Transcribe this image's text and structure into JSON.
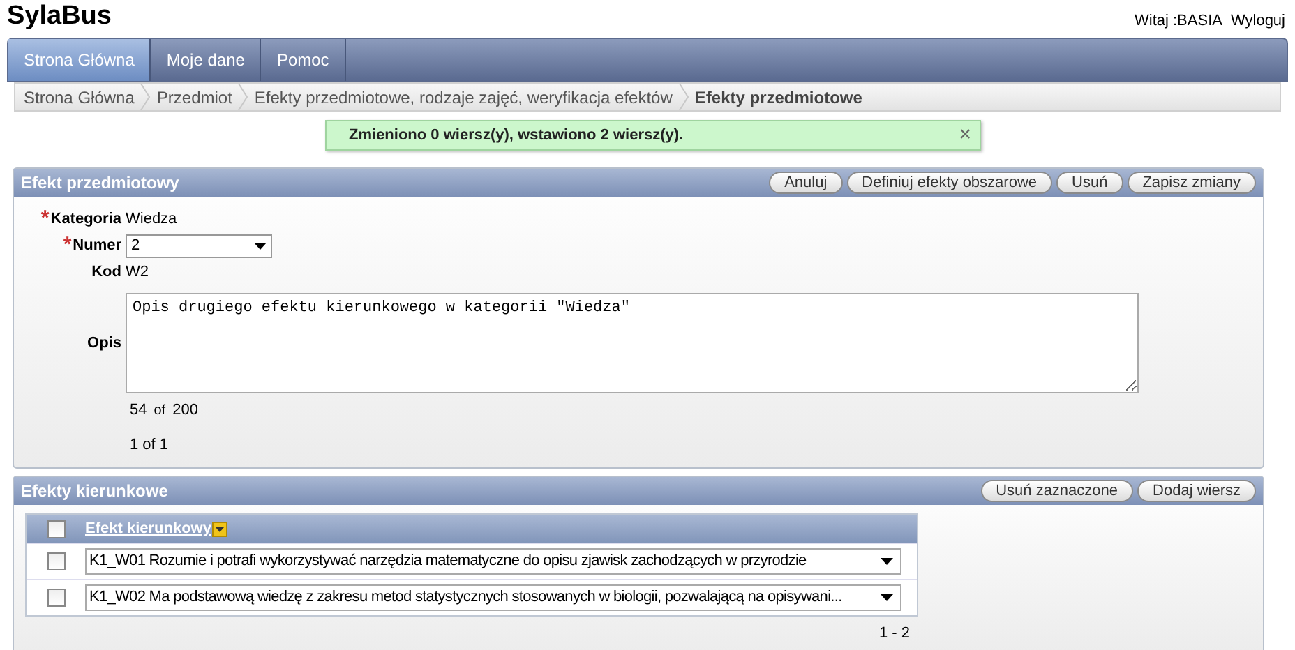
{
  "header": {
    "logo": "SylaBus",
    "greeting": "Witaj :BASIA",
    "logout": "Wyloguj"
  },
  "tabs": [
    {
      "label": "Strona Główna",
      "selected": true
    },
    {
      "label": "Moje dane",
      "selected": false
    },
    {
      "label": "Pomoc",
      "selected": false
    }
  ],
  "breadcrumb": [
    {
      "label": "Strona Główna",
      "current": false
    },
    {
      "label": "Przedmiot",
      "current": false
    },
    {
      "label": "Efekty przedmiotowe, rodzaje zajęć, weryfikacja efektów",
      "current": false
    },
    {
      "label": "Efekty przedmiotowe",
      "current": true
    }
  ],
  "message": {
    "text": "Zmieniono 0 wiersz(y), wstawiono 2 wiersz(y).",
    "close": "×"
  },
  "form_panel": {
    "title": "Efekt przedmiotowy",
    "buttons": [
      "Anuluj",
      "Definiuj efekty obszarowe",
      "Usuń",
      "Zapisz zmiany"
    ],
    "required_mark": "*",
    "fields": [
      {
        "kind": "text",
        "label": "Kategoria",
        "required": true,
        "value": "Wiedza"
      },
      {
        "kind": "select",
        "label": "Numer",
        "required": true,
        "value": "2"
      },
      {
        "kind": "text",
        "label": "Kod",
        "required": false,
        "value": "W2"
      },
      {
        "kind": "textarea",
        "label": "Opis",
        "required": false,
        "value": "Opis drugiego efektu kierunkowego w kategorii \"Wiedza\""
      }
    ],
    "counter": {
      "count": "54",
      "of": "of",
      "max": "200"
    },
    "pagination": "1 of 1"
  },
  "grid_panel": {
    "title": "Efekty kierunkowe",
    "buttons": [
      "Usuń zaznaczone",
      "Dodaj wiersz"
    ],
    "column": "Efekt kierunkowy",
    "header_checked": false,
    "rows": [
      {
        "checked": false,
        "value": "K1_W01 Rozumie i potrafi wykorzystywać narzędzia matematyczne do opisu zjawisk zachodzących w przyrodzie"
      },
      {
        "checked": false,
        "value": "K1_W02 Ma podstawową wiedzę z zakresu metod statystycznych stosowanych w biologii, pozwalającą na opisywani..."
      }
    ],
    "pagination": "1 - 2"
  }
}
